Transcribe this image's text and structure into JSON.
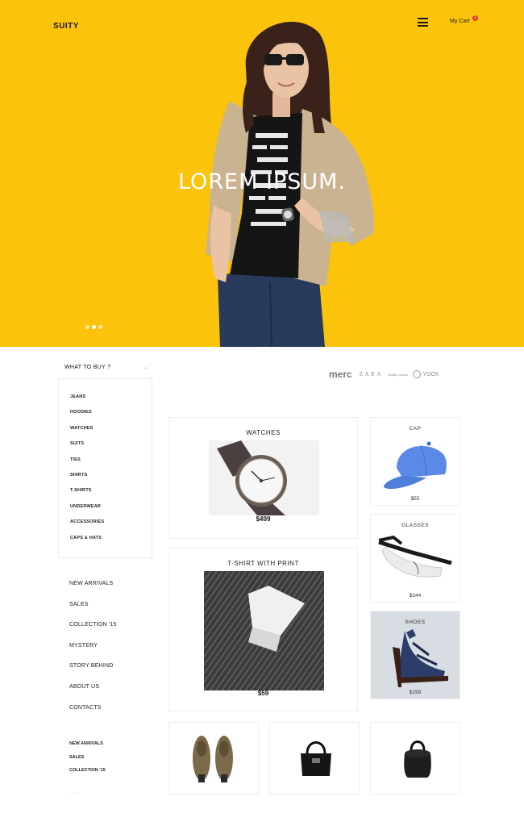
{
  "header": {
    "logo": "SUITY",
    "cart_label": "My Cart",
    "cart_count": "1"
  },
  "hero": {
    "title": "LOREM IPSUM.",
    "slides": 3,
    "active_slide": 1
  },
  "categories": {
    "heading": "WHAT TO BUY ?",
    "arrow": "⌄",
    "items": [
      "JEANS",
      "HOODIES",
      "WATCHES",
      "SUITS",
      "TIES",
      "SHIRTS",
      "T-SHIRTS",
      "UNDERWEAR",
      "ACCESSORIES",
      "CAPS & HATS"
    ]
  },
  "nav": {
    "items": [
      "NEW ARRIVALS",
      "SALES",
      "COLLECTION '15",
      "MYSTERY",
      "STORY BEHIND",
      "ABOUT US",
      "CONTACTS"
    ]
  },
  "subnav": {
    "items": [
      "NEW ARRIVALS",
      "SALES",
      "COLLECTION '15"
    ],
    "more": "· · ·"
  },
  "brands": {
    "merc": "merc",
    "zara": "ZARA",
    "ralph": "Ralph Lauren",
    "yoox": "YOOX"
  },
  "products": {
    "watches": {
      "title": "WATCHES",
      "price": "$499"
    },
    "tshirt": {
      "title": "T-SHIRT WITH PRINT",
      "price": "$59"
    },
    "cap": {
      "title": "CAP",
      "price": "$55"
    },
    "glasses": {
      "title": "GLASSES",
      "price": "$244"
    },
    "shoes": {
      "title": "SHOES",
      "price": "$199"
    }
  },
  "colors": {
    "accent": "#fcc30c",
    "badge": "#e23b2e"
  }
}
